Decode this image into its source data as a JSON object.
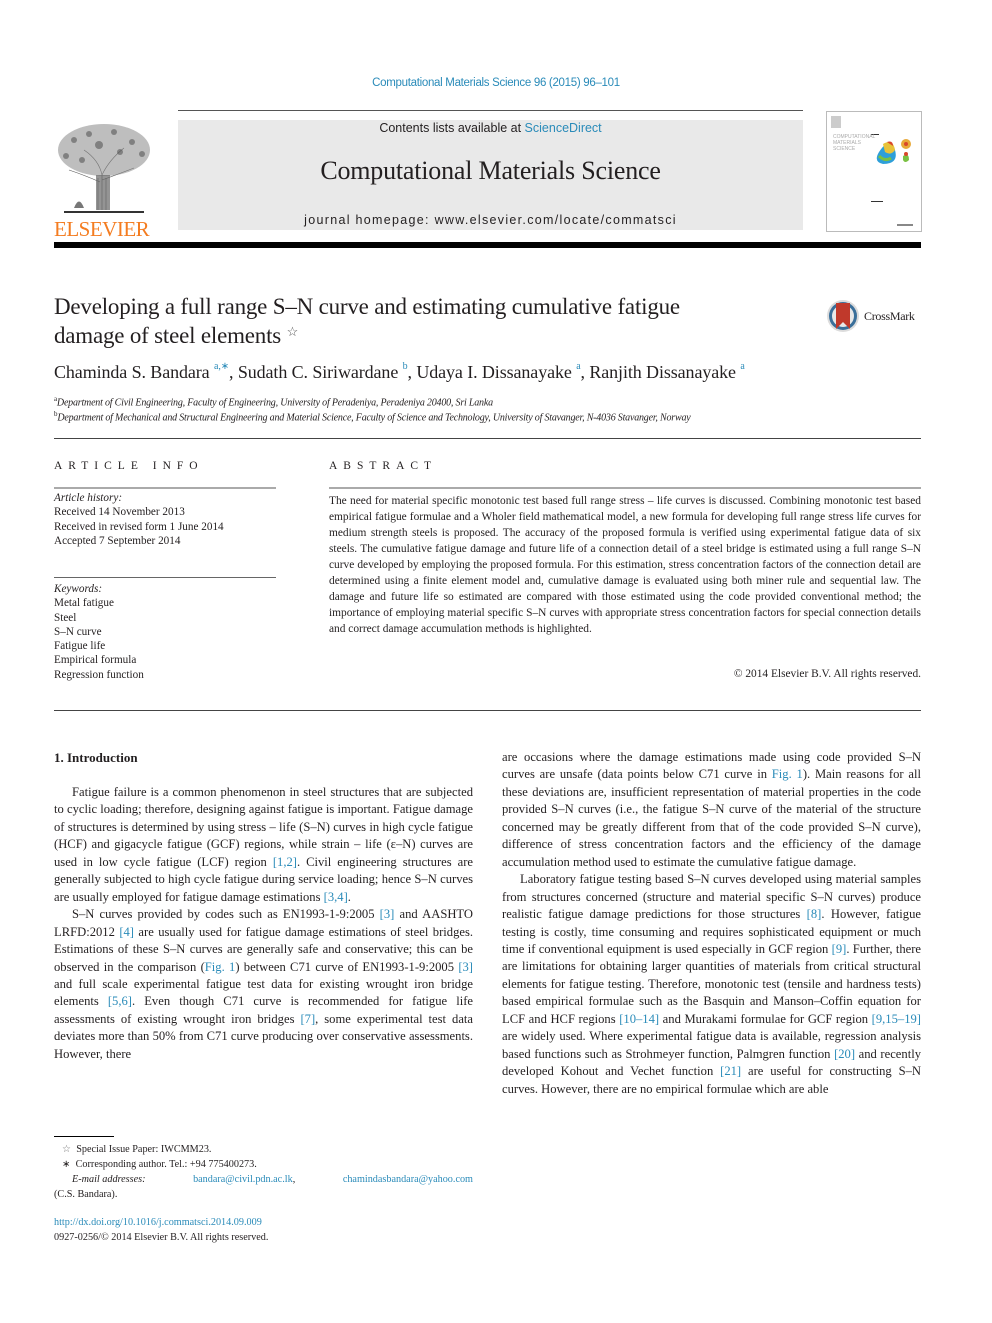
{
  "header": {
    "citation": "Computational Materials Science 96 (2015) 96–101",
    "contents_prefix": "Contents lists available at ",
    "contents_link": "ScienceDirect",
    "journal_title": "Computational Materials Science",
    "homepage_prefix": "journal homepage: ",
    "homepage_url": "www.elsevier.com/locate/commatsci",
    "publisher_logo_text": "ELSEVIER",
    "cover_title": "COMPUTATIONAL MATERIALS SCIENCE"
  },
  "article": {
    "title_line1": "Developing a full range S–N curve and estimating cumulative fatigue",
    "title_line2": "damage of steel elements",
    "title_mark": "☆",
    "crossmark_label": "CrossMark",
    "authors": [
      {
        "name": "Chaminda S. Bandara",
        "sup": "a,∗",
        "sep": ", "
      },
      {
        "name": "Sudath C. Siriwardane",
        "sup": "b",
        "sep": ", "
      },
      {
        "name": "Udaya I. Dissanayake",
        "sup": "a",
        "sep": ", "
      },
      {
        "name": "Ranjith Dissanayake",
        "sup": "a",
        "sep": ""
      }
    ],
    "affiliations": [
      {
        "sup": "a",
        "text": "Department of Civil Engineering, Faculty of Engineering, University of Peradeniya, Peradeniya 20400, Sri Lanka"
      },
      {
        "sup": "b",
        "text": "Department of Mechanical and Structural Engineering and Material Science, Faculty of Science and Technology, University of Stavanger, N-4036 Stavanger, Norway"
      }
    ]
  },
  "article_info": {
    "heading": "ARTICLE INFO",
    "history_label": "Article history:",
    "history": [
      "Received 14 November 2013",
      "Received in revised form 1 June 2014",
      "Accepted 7 September 2014"
    ],
    "keywords_label": "Keywords:",
    "keywords": [
      "Metal fatigue",
      "Steel",
      "S–N curve",
      "Fatigue life",
      "Empirical formula",
      "Regression function"
    ]
  },
  "abstract": {
    "heading": "ABSTRACT",
    "text": "The need for material specific monotonic test based full range stress – life curves is discussed. Combining monotonic test based empirical fatigue formulae and a Wholer field mathematical model, a new formula for developing full range stress life curves for medium strength steels is proposed. The accuracy of the proposed formula is verified using experimental fatigue data of six steels. The cumulative fatigue damage and future life of a connection detail of a steel bridge is estimated using a full range S–N curve developed by employing the proposed formula. For this estimation, stress concentration factors of the connection detail are determined using a finite element model and, cumulative damage is evaluated using both miner rule and sequential law. The damage and future life so estimated are compared with those estimated using the code provided conventional method; the importance of employing material specific S–N curves with appropriate stress concentration factors for special connection details and correct damage accumulation methods is highlighted.",
    "copyright": "© 2014 Elsevier B.V. All rights reserved."
  },
  "body": {
    "section_heading": "1. Introduction",
    "left_paragraphs": [
      [
        {
          "t": "Fatigue failure is a common phenomenon in steel structures that are subjected to cyclic loading; therefore, designing against fatigue is important. Fatigue damage of structures is determined by using stress – life (S–N) curves in high cycle fatigue (HCF) and gigacycle fatigue (GCF) regions, while strain – life (ε–N) curves are used in low cycle fatigue (LCF) region "
        },
        {
          "ref": "[1,2]"
        },
        {
          "t": ". Civil engineering structures are generally subjected to high cycle fatigue during service loading; hence S–N curves are usually employed for fatigue damage estimations "
        },
        {
          "ref": "[3,4]"
        },
        {
          "t": "."
        }
      ],
      [
        {
          "t": "S–N curves provided by codes such as EN1993-1-9:2005 "
        },
        {
          "ref": "[3]"
        },
        {
          "t": " and AASHTO LRFD:2012 "
        },
        {
          "ref": "[4]"
        },
        {
          "t": " are usually used for fatigue damage estimations of steel bridges. Estimations of these S–N curves are generally safe and conservative; this can be observed in the comparison ("
        },
        {
          "ref": "Fig. 1"
        },
        {
          "t": ") between C71 curve of EN1993-1-9:2005 "
        },
        {
          "ref": "[3]"
        },
        {
          "t": " and full scale experimental fatigue test data for existing wrought iron bridge elements "
        },
        {
          "ref": "[5,6]"
        },
        {
          "t": ". Even though C71 curve is recommended for fatigue life assessments of existing wrought iron bridges "
        },
        {
          "ref": "[7]"
        },
        {
          "t": ", some experimental test data deviates more than 50% from C71 curve producing over conservative assessments. However, there"
        }
      ]
    ],
    "right_paragraphs": [
      [
        {
          "t": "are occasions where the damage estimations made using code provided S–N curves are unsafe (data points below C71 curve in "
        },
        {
          "ref": "Fig. 1"
        },
        {
          "t": "). Main reasons for all these deviations are, insufficient representation of material properties in the code provided S–N curves (i.e., the fatigue S–N curve of the material of the structure concerned may be greatly different from that of the code provided S–N curve), difference of stress concentration factors and the efficiency of the damage accumulation method used to estimate the cumulative fatigue damage."
        }
      ],
      [
        {
          "t": "Laboratory fatigue testing based S–N curves developed using material samples from structures concerned (structure and material specific S–N curves) produce realistic fatigue damage predictions for those structures "
        },
        {
          "ref": "[8]"
        },
        {
          "t": ". However, fatigue testing is costly, time consuming and requires sophisticated equipment or much time if conventional equipment is used especially in GCF region "
        },
        {
          "ref": "[9]"
        },
        {
          "t": ". Further, there are limitations for obtaining larger quantities of materials from critical structural elements for fatigue testing. Therefore, monotonic test (tensile and hardness tests) based empirical formulae such as the Basquin and Manson–Coffin equation for LCF and HCF regions "
        },
        {
          "ref": "[10–14]"
        },
        {
          "t": " and Murakami formulae for GCF region "
        },
        {
          "ref": "[9,15–19]"
        },
        {
          "t": " are widely used. Where experimental fatigue data is available, regression analysis based functions such as Strohmeyer function, Palmgren function "
        },
        {
          "ref": "[20]"
        },
        {
          "t": " and recently developed Kohout and Vechet function "
        },
        {
          "ref": "[21]"
        },
        {
          "t": " are useful for constructing S–N curves. However, there are no empirical formulae which are able"
        }
      ]
    ]
  },
  "footnotes": {
    "star_mark": "☆",
    "star_text": "Special Issue Paper: IWCMM23.",
    "corr_mark": "∗",
    "corr_text": "Corresponding author. Tel.: +94 775400273.",
    "email_label": "E-mail addresses:",
    "email1": "bandara@civil.pdn.ac.lk",
    "email_sep": ",",
    "email2": "chamindasbandara@yahoo.com",
    "email_owner": "(C.S. Bandara).",
    "doi": "http://dx.doi.org/10.1016/j.commatsci.2014.09.009",
    "issn": "0927-0256/© 2014 Elsevier B.V. All rights reserved."
  },
  "colors": {
    "link": "#2a8bb9",
    "elsevier_orange": "#f47c20",
    "banner_bg": "#e9e9e9"
  }
}
